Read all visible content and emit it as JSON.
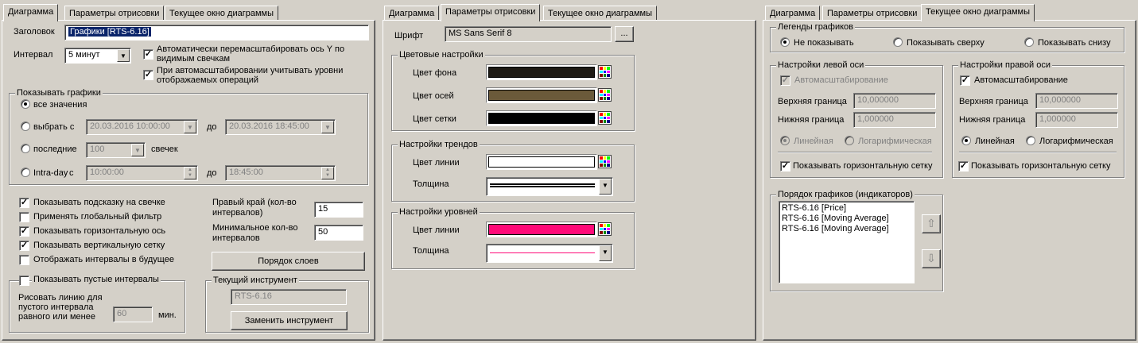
{
  "tabs": [
    "Диаграмма",
    "Параметры отрисовки",
    "Текущее окно диаграммы"
  ],
  "p1": {
    "title_label": "Заголовок",
    "title_value": "Графики [RTS-6.16]",
    "interval_label": "Интервал",
    "interval_value": "5 минут",
    "auto_rescale": "Автоматически перемасштабировать ось Y по видимым свечкам",
    "auto_rescale_line1": "Автоматически перемасштабировать ось Y по",
    "auto_rescale_line2": "видимым свечкам",
    "consider_levels_line1": "При автомасштабировании учитывать уровни",
    "consider_levels_line2": "отображаемых операций",
    "show_group": "Показывать графики",
    "all_values": "все значения",
    "choose_from": "выбрать с",
    "from_date": "20.03.2016 10:00:00",
    "to_label": "до",
    "to_date": "20.03.2016 18:45:00",
    "last_label": "последние",
    "last_count": "100",
    "candles_label": "свечек",
    "intraday_label": "Intra-day",
    "intraday_c": "с",
    "intraday_from": "10:00:00",
    "intraday_to": "18:45:00",
    "show_hint": "Показывать подсказку на свечке",
    "global_filter": "Применять глобальный фильтр",
    "show_h_axis": "Показывать горизонтальную ось",
    "show_v_grid": "Показывать вертикальную сетку",
    "future_intervals": "Отображать интервалы в будущее",
    "right_edge_line1": "Правый край (кол-во",
    "right_edge_line2": "интервалов)",
    "right_edge_value": "15",
    "min_count_line1": "Минимальное кол-во",
    "min_count_line2": "интервалов",
    "min_count_value": "50",
    "layer_order_btn": "Порядок слоев",
    "show_empty": "Показывать пустые интервалы",
    "draw_line1": "Рисовать линию для",
    "draw_line2": "пустого интервала",
    "draw_line3": "равного или менее",
    "empty_value": "60",
    "min_label": "мин.",
    "instrument_group": "Текущий инструмент",
    "instrument_value": "RTS-6.16",
    "replace_btn": "Заменить инструмент"
  },
  "p2": {
    "font_label": "Шрифт",
    "font_value": "MS Sans Serif 8",
    "font_btn": "...",
    "colors_group": "Цветовые настройки",
    "bg_color": "Цвет фона",
    "axis_color": "Цвет осей",
    "grid_color": "Цвет сетки",
    "trend_group": "Настройки трендов",
    "trend_line_color": "Цвет линии",
    "trend_width": "Толщина",
    "level_group": "Настройки уровней",
    "level_line_color": "Цвет линии",
    "level_width": "Толщина",
    "colors": {
      "bg": "#1e1a14",
      "axis": "#6b5a3a",
      "grid": "#000000",
      "trend": "#ffffff",
      "level": "#ff0a78"
    }
  },
  "p3": {
    "legend_group": "Легенды графиков",
    "legend_none": "Не показывать",
    "legend_top": "Показывать сверху",
    "legend_bottom": "Показывать снизу",
    "left_axis_group": "Настройки левой оси",
    "right_axis_group": "Настройки правой оси",
    "autoscale": "Автомасштабирование",
    "upper": "Верхняя граница",
    "lower": "Нижняя граница",
    "upper_value": "10,000000",
    "lower_value": "1,000000",
    "linear": "Линейная",
    "log": "Логарифмическая",
    "show_h_grid": "Показывать горизонтальную сетку",
    "order_group": "Порядок графиков (индикаторов)",
    "order_items": [
      "RTS-6.16 [Price]",
      "RTS-6.16 [Moving Average]",
      "RTS-6.16 [Moving Average]"
    ]
  }
}
